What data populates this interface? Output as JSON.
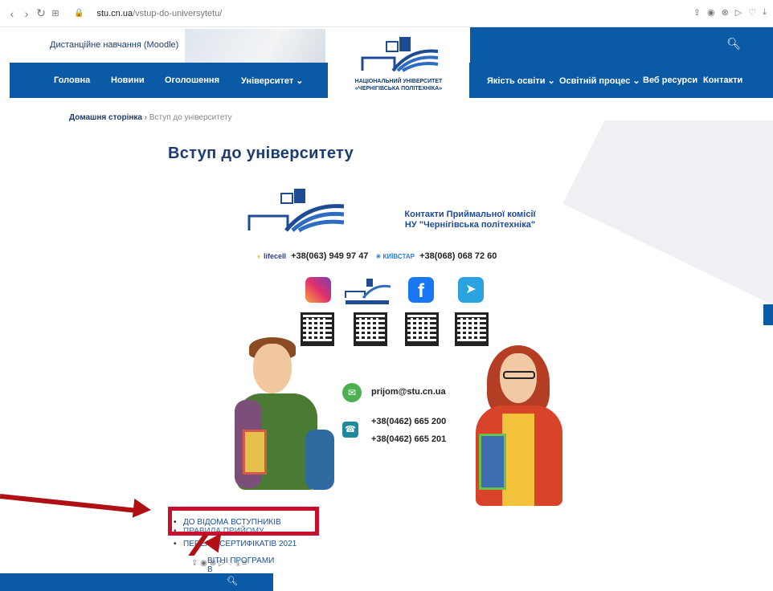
{
  "browser": {
    "url_domain": "stu.cn.ua",
    "url_path": "/vstup-do-universytetu/"
  },
  "header": {
    "moodle_link": "Дистанційне навчання (Moodle)",
    "logo_line1": "НАЦІОНАЛЬНИЙ УНІВЕРСИТЕТ",
    "logo_line2": "«ЧЕРНІГІВСЬКА ПОЛІТЕХНІКА»",
    "nav_left": [
      "Головна",
      "Новини",
      "Оголошення",
      "Університет ⌄"
    ],
    "nav_right": [
      "Якість освіти ⌄",
      "Освітній процес ⌄",
      "Веб ресурси",
      "Контакти"
    ]
  },
  "breadcrumb": {
    "home": "Домашня сторінка",
    "separator": "›",
    "current": "Вступ до університету"
  },
  "main": {
    "title": "Вступ до університету"
  },
  "poster": {
    "title_line1": "Контакти Приймальної комісії",
    "title_line2": "НУ \"Чернігівська політехніка\"",
    "lifecell_label": "lifecell",
    "phone_lifecell": "+38(063) 949 97 47",
    "kyivstar_label": "КИЇВСТАР",
    "phone_kyivstar": "+38(068) 068 72 60",
    "email": "prijom@stu.cn.ua",
    "phone_1": "+38(0462) 665 200",
    "phone_2": "+38(0462) 665 201"
  },
  "links": [
    "ДО ВІДОМА ВСТУПНИКІВ",
    "ПРАВИЛА ПРИЙОМУ",
    "ПЕРЕЛІК СЕРТИФІКАТІВ 2021",
    "ОСВІТНІ ПРОГРАМИ",
    "В"
  ],
  "overlay": {
    "text_line1": "ВІТНІ ПРОГРАМИ",
    "text_line2": "В"
  },
  "colors": {
    "brand_blue": "#0a5aa6",
    "title_blue": "#1d3b70",
    "highlight_red": "#c8102e"
  }
}
